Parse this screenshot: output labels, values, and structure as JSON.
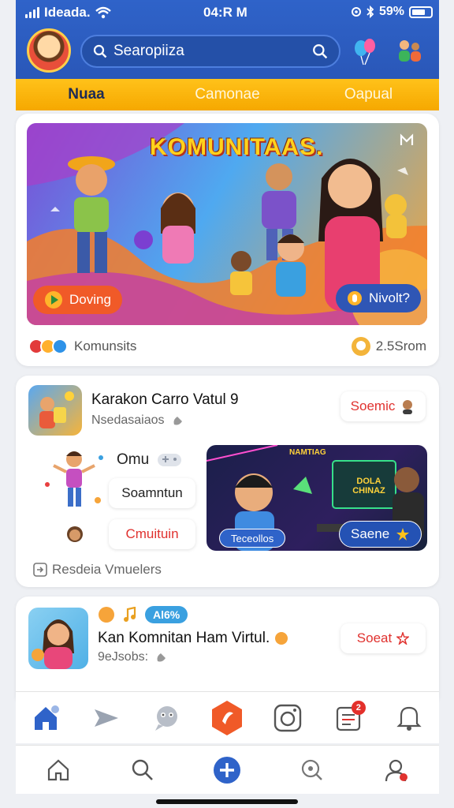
{
  "status_bar": {
    "carrier": "Ideada.",
    "time": "04:R M",
    "battery": "59%"
  },
  "header": {
    "search_placeholder": "Searopiiza"
  },
  "tabs": [
    {
      "label": "Nuaa",
      "active": true
    },
    {
      "label": "Camonae",
      "active": false
    },
    {
      "label": "Oapual",
      "active": false
    }
  ],
  "hero_card": {
    "banner_title": "KOMUNITAAS.",
    "play_button_label": "Doving",
    "action_button_label": "Nivolt?",
    "community_label": "Komunsits",
    "count": "2.5Srom"
  },
  "post1": {
    "title": "Karakon Carro Vatul 9",
    "subtitle": "Nsedasaiaos",
    "action_button": "Soemic",
    "chips": [
      "Omu",
      "Soamntun",
      "Cmuituin"
    ],
    "media_left_label": "Teceollos",
    "media_right_label": "Saene",
    "media_banner_text": "DOLA CHINAZ",
    "footer": "Resdeia Vmuelers"
  },
  "post2": {
    "badge": "Al6%",
    "title": "Kan Komnitan Ham Virtul.",
    "subtitle": "9eJsobs:",
    "action_button": "Soeat"
  },
  "bottom_nav_top": {
    "items": [
      "home-icon",
      "share-icon",
      "chat-bot-icon",
      "create-icon",
      "camera-icon",
      "news-icon",
      "bell-icon"
    ],
    "news_badge": "2"
  },
  "bottom_nav": {
    "items": [
      "home-outline-icon",
      "search-icon",
      "add-icon",
      "explore-icon",
      "profile-icon"
    ]
  },
  "colors": {
    "header_blue": "#2f63c9",
    "tab_yellow": "#ffc21a",
    "accent_red": "#e0322f",
    "accent_orange": "#f05a28"
  }
}
